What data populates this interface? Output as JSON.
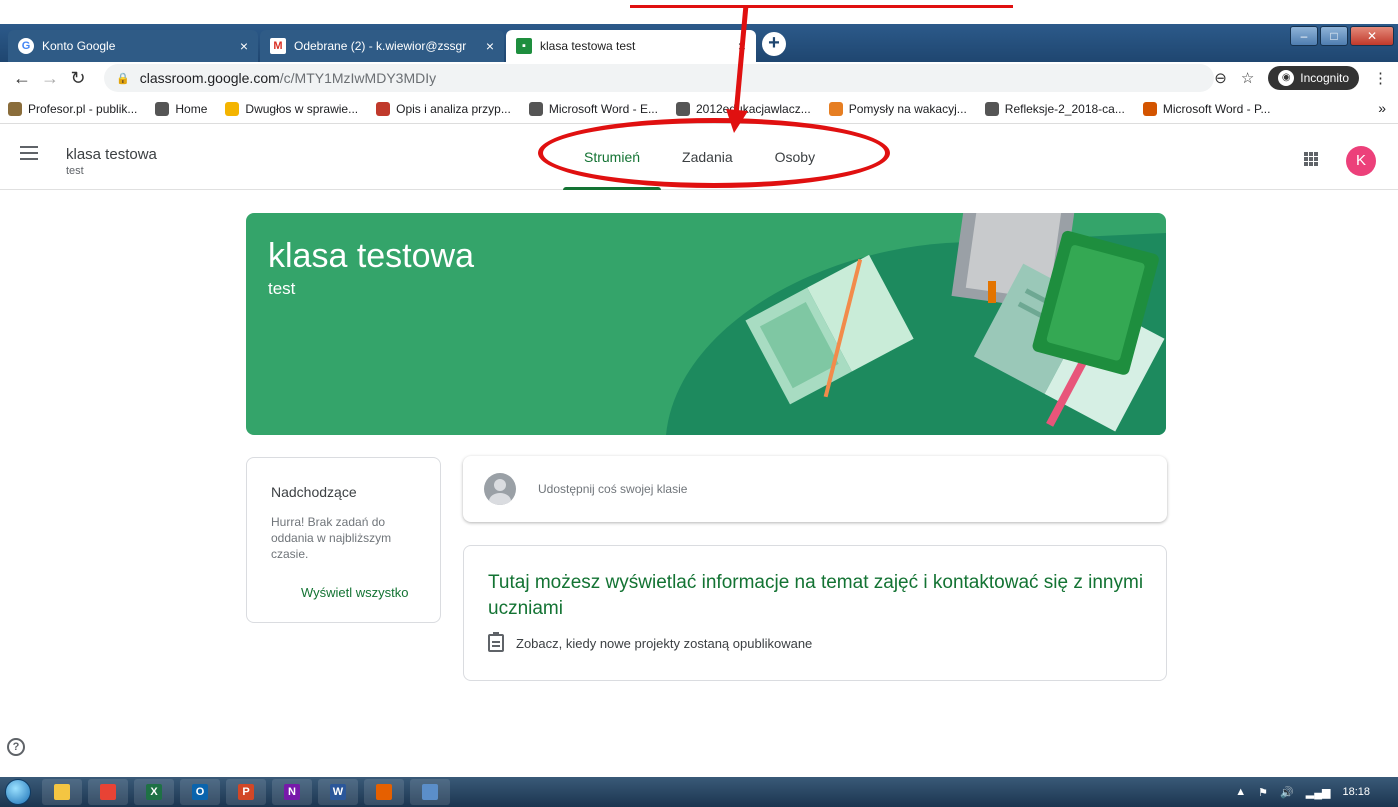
{
  "browser": {
    "tabs": [
      {
        "title": "Konto Google",
        "icon": "google-icon",
        "active": false
      },
      {
        "title": "Odebrane (2) - k.wiewior@zssgr",
        "icon": "gmail-icon",
        "active": false
      },
      {
        "title": "klasa testowa test",
        "icon": "classroom-icon",
        "active": true
      }
    ],
    "new_tab": "+",
    "url_host": "classroom.google.com",
    "url_path": "/c/MTY1MzIwMDY3MDIy",
    "incognito_label": "Incognito",
    "bookmarks": [
      {
        "label": "Profesor.pl - publik...",
        "color": "#8a6d3b"
      },
      {
        "label": "Home",
        "color": "#555555"
      },
      {
        "label": "Dwugłos w sprawie...",
        "color": "#f4b400"
      },
      {
        "label": "Opis i analiza przyp...",
        "color": "#c0392b"
      },
      {
        "label": "Microsoft Word - E...",
        "color": "#555555"
      },
      {
        "label": "2012edukacjawlacz...",
        "color": "#555555"
      },
      {
        "label": "Pomysły na wakacyj...",
        "color": "#e67e22"
      },
      {
        "label": "Refleksje-2_2018-ca...",
        "color": "#555555"
      },
      {
        "label": "Microsoft Word - P...",
        "color": "#d35400"
      }
    ],
    "bookmarks_more": "»"
  },
  "classroom": {
    "class_name": "klasa testowa",
    "section": "test",
    "tabs": [
      {
        "label": "Strumień",
        "active": true
      },
      {
        "label": "Zadania",
        "active": false
      },
      {
        "label": "Osoby",
        "active": false
      }
    ],
    "avatar_letter": "K",
    "banner": {
      "title": "klasa testowa",
      "subtitle": "test",
      "color": "#34a46a"
    },
    "upcoming": {
      "title": "Nadchodzące",
      "text": "Hurra! Brak zadań do oddania w najbliższym czasie.",
      "link": "Wyświetl wszystko"
    },
    "share_placeholder": "Udostępnij coś swojej klasie",
    "info": {
      "title": "Tutaj możesz wyświetlać informacje na temat zajęć i kontaktować się z innymi uczniami",
      "row": "Zobacz, kiedy nowe projekty zostaną opublikowane"
    },
    "help": "?"
  },
  "taskbar": {
    "apps": [
      {
        "name": "explorer",
        "label": "",
        "color": "#f4c542"
      },
      {
        "name": "chrome",
        "label": "",
        "color": "#e84335"
      },
      {
        "name": "excel",
        "label": "X",
        "color": "#1e7145"
      },
      {
        "name": "outlook",
        "label": "O",
        "color": "#0a64ad"
      },
      {
        "name": "powerpoint",
        "label": "P",
        "color": "#d24726"
      },
      {
        "name": "onenote",
        "label": "N",
        "color": "#7719aa"
      },
      {
        "name": "word",
        "label": "W",
        "color": "#2b579a"
      },
      {
        "name": "firefox",
        "label": "",
        "color": "#e66000"
      },
      {
        "name": "paint",
        "label": "",
        "color": "#5b8ec9"
      }
    ],
    "clock": "18:18"
  },
  "accent_color": "#137333",
  "annotation_color": "#e01010"
}
